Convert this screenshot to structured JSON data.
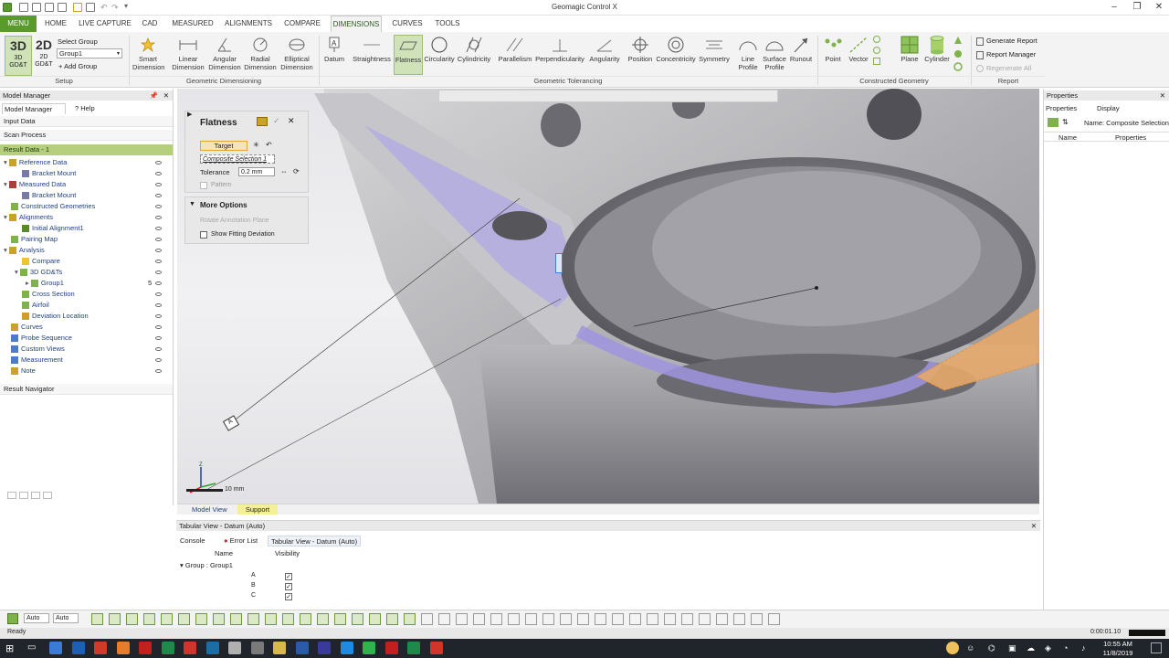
{
  "app": {
    "title": "Geomagic Control X"
  },
  "menu_tabs": [
    {
      "label": "MENU"
    },
    {
      "label": "HOME"
    },
    {
      "label": "LIVE CAPTURE"
    },
    {
      "label": "CAD"
    },
    {
      "label": "MEASURED"
    },
    {
      "label": "ALIGNMENTS"
    },
    {
      "label": "COMPARE"
    },
    {
      "label": "DIMENSIONS"
    },
    {
      "label": "CURVES"
    },
    {
      "label": "TOOLS"
    }
  ],
  "ribbon": {
    "setup": {
      "btn_3d": "3D",
      "btn_3d_sub": "3D GD&T",
      "btn_2d": "2D",
      "btn_2d_sub": "2D GD&T",
      "select_group_label": "Select Group",
      "select_group_value": "Group1",
      "add_group": "Add Group",
      "group_label": "Setup"
    },
    "geometric_dimensioning": {
      "buttons": [
        "Smart Dimension",
        "Linear Dimension",
        "Angular Dimension",
        "Radial Dimension",
        "Elliptical Dimension"
      ],
      "group_label": "Geometric Dimensioning"
    },
    "geometric_tolerancing": {
      "buttons": [
        "Datum",
        "Straightness",
        "Flatness",
        "Circularity",
        "Cylindricity",
        "Parallelism",
        "Perpendicularity",
        "Angularity",
        "Position",
        "Concentricity",
        "Symmetry",
        "Line Profile",
        "Surface Profile",
        "Runout"
      ],
      "group_label": "Geometric Tolerancing"
    },
    "constructed_geometry": {
      "buttons": [
        "Point",
        "Vector",
        "Plane",
        "Cylinder"
      ],
      "group_label": "Constructed Geometry"
    },
    "report": {
      "buttons": [
        "Generate Report",
        "Report Manager",
        "Regenerate All"
      ],
      "group_label": "Report"
    }
  },
  "model_manager": {
    "title": "Model Manager",
    "tabs": [
      "Model Manager",
      "Help"
    ],
    "sections": [
      "Input Data",
      "Scan Process"
    ],
    "result_data": "Result Data - 1",
    "tree": [
      {
        "label": "Reference Data",
        "indent": 0,
        "bold": false
      },
      {
        "label": "Bracket Mount",
        "indent": 1
      },
      {
        "label": "Measured Data",
        "indent": 0
      },
      {
        "label": "Bracket Mount",
        "indent": 1
      },
      {
        "label": "Constructed Geometries",
        "indent": 0
      },
      {
        "label": "Alignments",
        "indent": 0
      },
      {
        "label": "Initial Alignment1",
        "indent": 1
      },
      {
        "label": "Pairing Map",
        "indent": 0
      },
      {
        "label": "Analysis",
        "indent": 0
      },
      {
        "label": "Compare",
        "indent": 1
      },
      {
        "label": "3D GD&Ts",
        "indent": 1
      },
      {
        "label": "Group1",
        "indent": 2,
        "count": "5"
      },
      {
        "label": "Cross Section",
        "indent": 1
      },
      {
        "label": "Airfoil",
        "indent": 1
      },
      {
        "label": "Deviation Location",
        "indent": 1
      },
      {
        "label": "Curves",
        "indent": 0
      },
      {
        "label": "Probe Sequence",
        "indent": 0
      },
      {
        "label": "Custom Views",
        "indent": 0
      },
      {
        "label": "Measurement",
        "indent": 0
      },
      {
        "label": "Note",
        "indent": 0
      }
    ],
    "result_navigator": "Result Navigator"
  },
  "flatness_panel": {
    "title": "Flatness",
    "target_label": "Target",
    "composite_selection": "Composite Selection 1",
    "tolerance_label": "Tolerance",
    "tolerance_value": "0.2 mm",
    "pattern_label": "Pattern",
    "more_options": "More Options",
    "rotate_annotation": "Rotate Annotation Plane",
    "show_fitting": "Show Fitting Deviation"
  },
  "viewport": {
    "scale_label": "10 mm",
    "datum_label": "A",
    "tabs": [
      "Model View",
      "Support"
    ]
  },
  "properties": {
    "title": "Properties",
    "tabs": [
      "Properties",
      "Display"
    ],
    "name_label": "Name: Composite Selection",
    "columns": [
      "Name",
      "Properties"
    ]
  },
  "tabular": {
    "title": "Tabular View - Datum (Auto)",
    "tabs": [
      "Console",
      "Error List",
      "Tabular View - Datum (Auto)"
    ],
    "columns": [
      "Name",
      "Visibility"
    ],
    "group": "Group : Group1",
    "rows": [
      {
        "name": "A",
        "visible": true
      },
      {
        "name": "B",
        "visible": true
      },
      {
        "name": "C",
        "visible": true
      }
    ]
  },
  "statusbar": {
    "auto1": "Auto",
    "auto2": "Auto",
    "ready": "Ready",
    "timer": "0:00:01.10"
  },
  "taskbar": {
    "time": "10:55 AM",
    "date": "11/8/2019"
  },
  "colors": {
    "accent_green": "#5a9a2d",
    "selection_purple": "#8c7fd6",
    "selection_orange": "#e8923a"
  }
}
